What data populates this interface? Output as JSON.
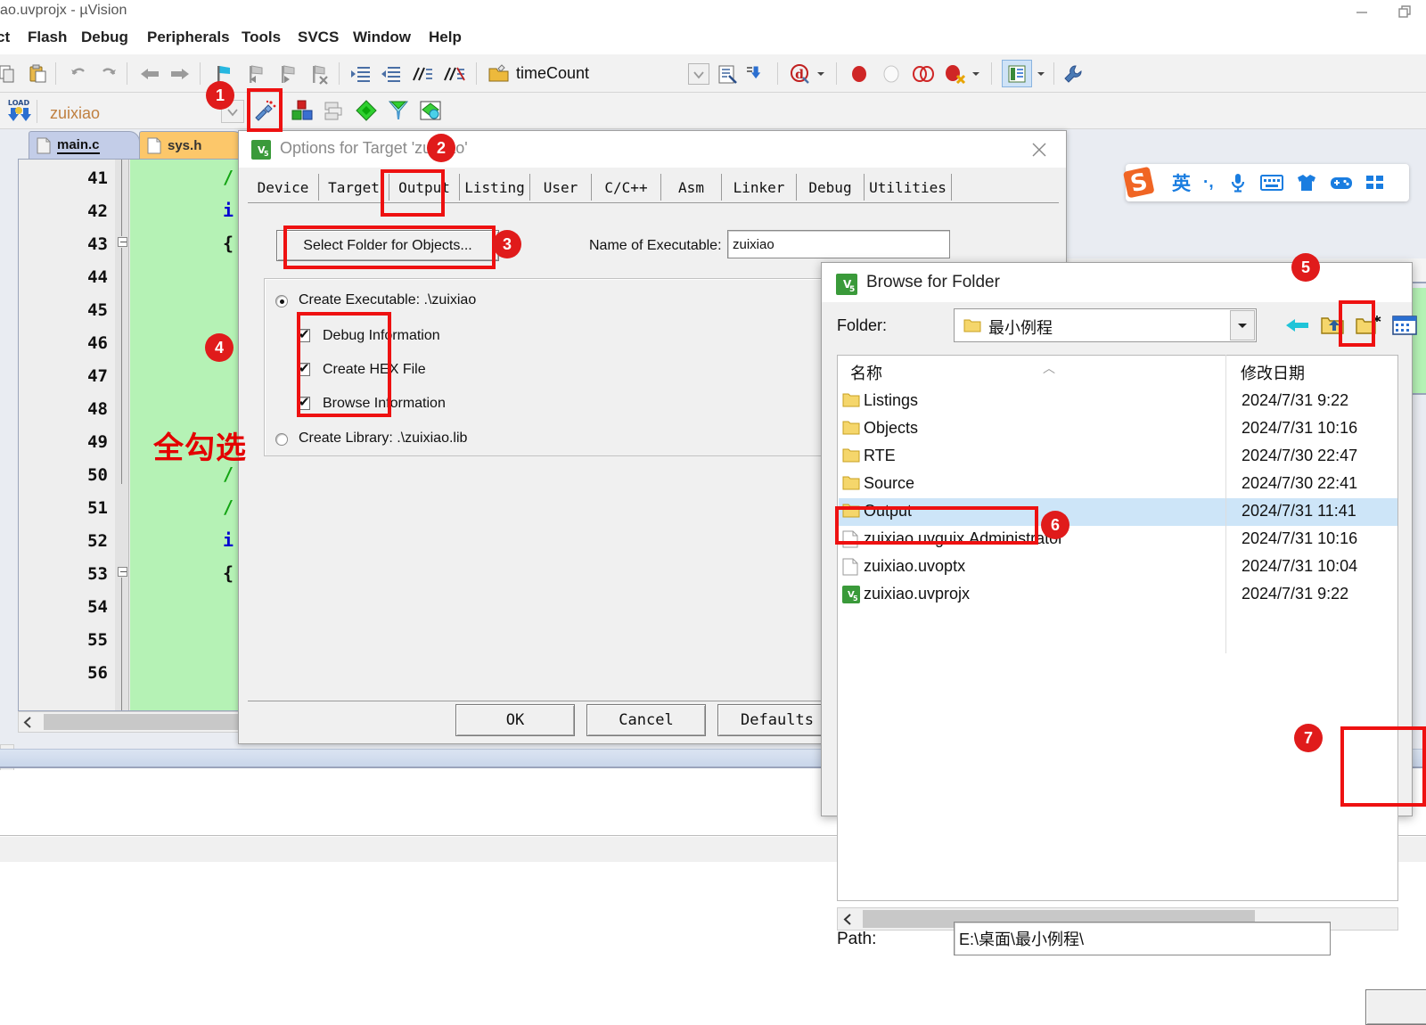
{
  "window": {
    "title": "ao.uvprojx - µVision",
    "minimize_label": "Minimize",
    "restore_label": "Restore"
  },
  "menu": {
    "items": [
      "ct",
      "Flash",
      "Debug",
      "Peripherals",
      "Tools",
      "SVCS",
      "Window",
      "Help"
    ]
  },
  "toolbar": {
    "target_value": "timeCount",
    "project_value": "zuixiao",
    "icons": [
      "copy-icon",
      "paste-icon",
      "undo-icon",
      "redo-icon",
      "navigate-back-icon",
      "navigate-forward-icon",
      "bookmark-toggle-icon",
      "bookmark-prev-icon",
      "bookmark-next-icon",
      "bookmark-clear-icon",
      "indent-increase-icon",
      "indent-decrease-icon",
      "comment-icon",
      "uncomment-icon",
      "open-file-icon",
      "target-options-icon",
      "find-in-files-icon",
      "insert-breakpoint-icon",
      "kill-breakpoints-icon",
      "disable-breakpoint-icon",
      "enable-breakpoint-icon",
      "bookmarks-list-icon",
      "configure-icon"
    ],
    "project_icons": [
      "load-icon",
      "build-target-icon",
      "batch-build-icon",
      "translate-icon",
      "build-icon",
      "rebuild-icon",
      "manage-project-icon"
    ]
  },
  "editor": {
    "tabs": [
      {
        "label": "main.c",
        "active": true
      },
      {
        "label": "sys.h",
        "active": false
      }
    ],
    "line_numbers": [
      "41",
      "42",
      "43",
      "44",
      "45",
      "46",
      "47",
      "48",
      "49",
      "50",
      "51",
      "52",
      "53",
      "54",
      "55",
      "56"
    ],
    "code_tokens": [
      {
        "line": 41,
        "text": "/",
        "color": "#13a413"
      },
      {
        "line": 42,
        "text": "i",
        "color": "#0000d0"
      },
      {
        "line": 43,
        "text": "{",
        "color": "#111111"
      },
      {
        "line": 50,
        "text": "/",
        "color": "#13a413"
      },
      {
        "line": 51,
        "text": "/",
        "color": "#13a413"
      },
      {
        "line": 52,
        "text": "i",
        "color": "#0000d0"
      },
      {
        "line": 53,
        "text": "{",
        "color": "#111111"
      }
    ]
  },
  "options_dialog": {
    "title": "Options for Target 'zuixiao'",
    "close_label": "Close",
    "tabs": [
      "Device",
      "Target",
      "Output",
      "Listing",
      "User",
      "C/C++",
      "Asm",
      "Linker",
      "Debug",
      "Utilities"
    ],
    "active_tab": "Output",
    "select_folder_button": "Select Folder for Objects...",
    "name_of_executable_label": "Name of Executable:",
    "name_of_executable_value": "zuixiao",
    "create_executable_label": "Create Executable:  .\\zuixiao",
    "create_executable_checked": true,
    "checkboxes": [
      {
        "label": "Debug Information",
        "checked": true
      },
      {
        "label": "Create HEX File",
        "checked": true
      },
      {
        "label": "Browse Information",
        "checked": true
      }
    ],
    "create_library_label": "Create Library:  .\\zuixiao.lib",
    "create_library_checked": false,
    "buttons": [
      "OK",
      "Cancel",
      "Defaults"
    ]
  },
  "browse_dialog": {
    "title": "Browse for Folder",
    "folder_label": "Folder:",
    "folder_value": "最小例程",
    "nav_icons": [
      "back-arrow-icon",
      "up-folder-icon",
      "new-folder-icon",
      "view-list-icon"
    ],
    "columns": [
      "名称",
      "修改日期"
    ],
    "rows": [
      {
        "name": "Listings",
        "date": "2024/7/31 9:22",
        "type": "folder",
        "selected": false
      },
      {
        "name": "Objects",
        "date": "2024/7/31 10:16",
        "type": "folder",
        "selected": false
      },
      {
        "name": "RTE",
        "date": "2024/7/30 22:47",
        "type": "folder",
        "selected": false
      },
      {
        "name": "Source",
        "date": "2024/7/30 22:41",
        "type": "folder",
        "selected": false
      },
      {
        "name": "Output",
        "date": "2024/7/31 11:41",
        "type": "folder",
        "selected": true
      },
      {
        "name": "zuixiao.uvguix.Administrator",
        "date": "2024/7/31 10:16",
        "type": "file",
        "selected": false
      },
      {
        "name": "zuixiao.uvoptx",
        "date": "2024/7/31 10:04",
        "type": "file",
        "selected": false
      },
      {
        "name": "zuixiao.uvprojx",
        "date": "2024/7/31 9:22",
        "type": "uvision",
        "selected": false
      }
    ],
    "path_label": "Path:",
    "path_value": "E:\\桌面\\最小例程\\"
  },
  "annotations": {
    "badges": [
      "1",
      "2",
      "3",
      "4",
      "5",
      "6",
      "7"
    ],
    "note_text": "全勾选",
    "accent_color": "#ee1111",
    "badge_color": "#e01b1b"
  },
  "ime": {
    "name": "sogou-input-method",
    "mode_label": "英",
    "punct_label": "·,",
    "icons": [
      "microphone-icon",
      "keyboard-icon",
      "skin-icon",
      "game-icon",
      "apps-icon"
    ]
  }
}
